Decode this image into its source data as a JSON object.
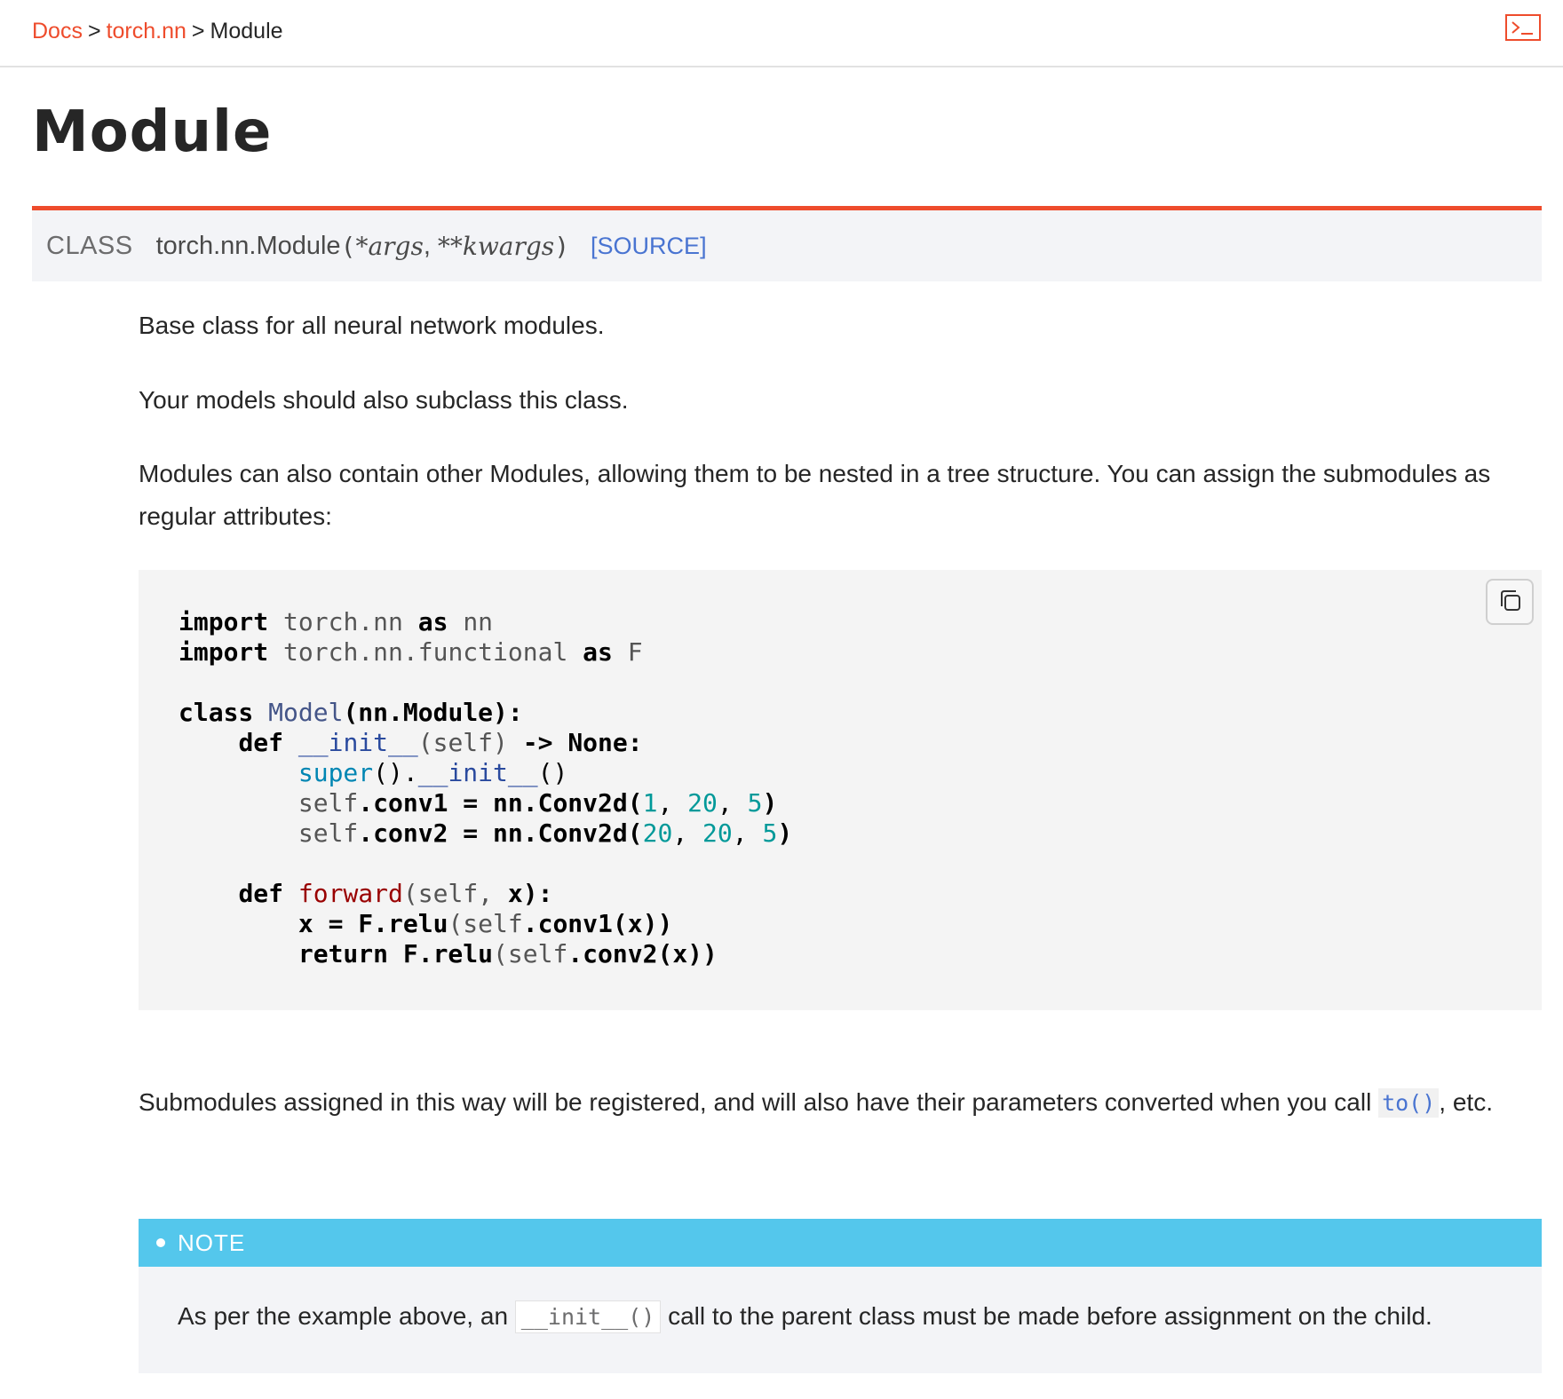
{
  "breadcrumb": {
    "docs": "Docs",
    "separator": ">",
    "torch_nn": "torch.nn",
    "current": "Module"
  },
  "header": {
    "title": "Module",
    "terminal_icon": "terminal-icon"
  },
  "signature": {
    "kind": "CLASS",
    "name": "torch.nn.Module",
    "open_paren": "(",
    "arg1": "*args",
    "comma": ",",
    "arg2": "**kwargs",
    "close_paren": ")",
    "source_link": "[SOURCE]"
  },
  "content": {
    "para1": "Base class for all neural network modules.",
    "para2": "Your models should also subclass this class.",
    "para3": "Modules can also contain other Modules, allowing them to be nested in a tree structure. You can assign the submodules as regular attributes:",
    "para4_before": "Submodules assigned in this way will be registered, and will also have their parameters converted when you call ",
    "para4_code": "to()",
    "para4_after": ", etc."
  },
  "code": {
    "copy_icon": "copy-icon",
    "lines": [
      "import torch.nn as nn",
      "import torch.nn.functional as F",
      "",
      "class Model(nn.Module):",
      "    def __init__(self) -> None:",
      "        super().__init__()",
      "        self.conv1 = nn.Conv2d(1, 20, 5)",
      "        self.conv2 = nn.Conv2d(20, 20, 5)",
      "",
      "    def forward(self, x):",
      "        x = F.relu(self.conv1(x))",
      "        return F.relu(self.conv2(x))"
    ]
  },
  "note": {
    "label": "NOTE",
    "text_before": "As per the example above, an ",
    "code": "__init__()",
    "text_after": " call to the parent class must be made before assignment on the child."
  },
  "colors": {
    "brand_orange": "#ee4c2c",
    "link_blue": "#4974d1",
    "note_blue": "#54c7ec",
    "signature_bg": "#f3f4f7",
    "code_bg": "#f4f4f4"
  }
}
